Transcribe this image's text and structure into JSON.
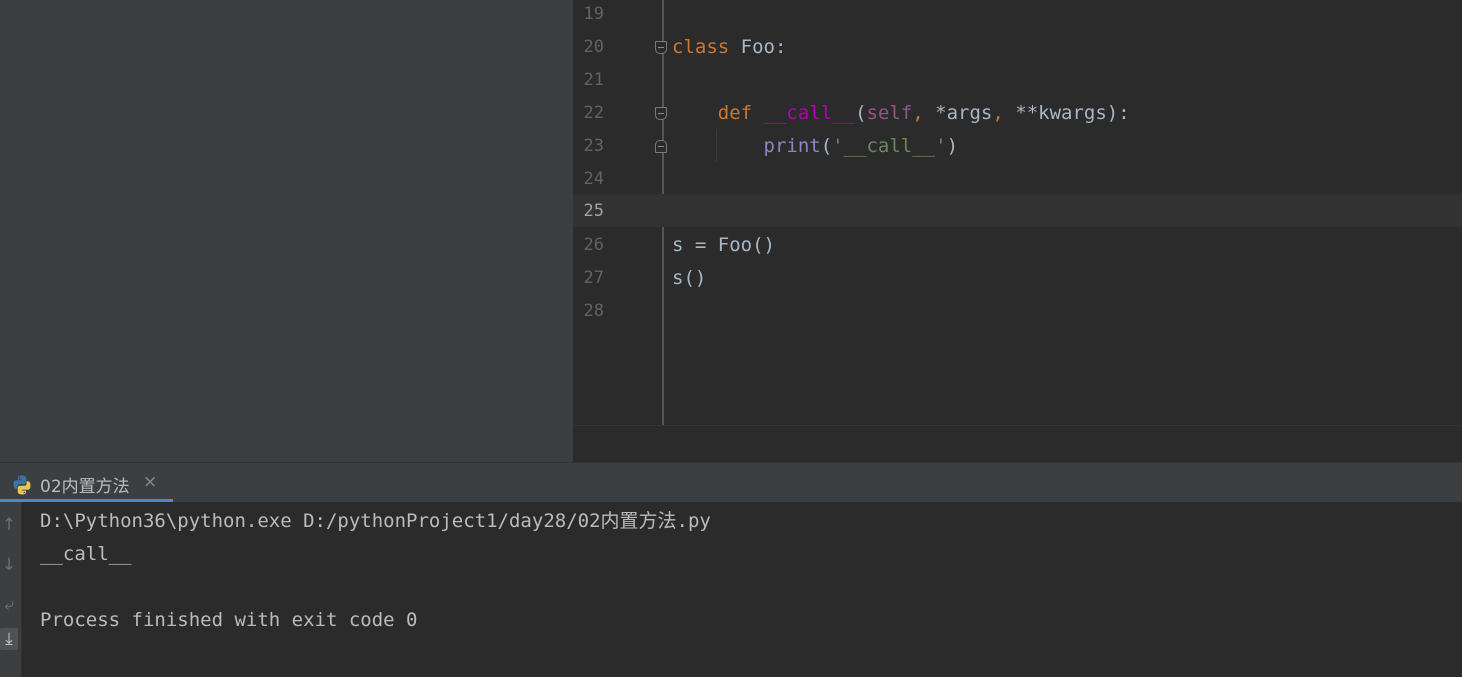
{
  "editor": {
    "lines": [
      {
        "no": "19"
      },
      {
        "no": "20",
        "t1": "class",
        "t2": " Foo:"
      },
      {
        "no": "21"
      },
      {
        "no": "22",
        "t1": "    ",
        "t2": "def",
        "t3": " ",
        "t4": "__call__",
        "t5": "(",
        "t6": "self",
        "t7": ",",
        "t8": " *args",
        "t9": ",",
        "t10": " **kwargs):"
      },
      {
        "no": "23",
        "t1": "        ",
        "t2": "print",
        "t3": "(",
        "t4": "'__call__'",
        "t5": ")"
      },
      {
        "no": "24"
      },
      {
        "no": "25"
      },
      {
        "no": "26",
        "t1": "s = Foo()"
      },
      {
        "no": "27",
        "t1": "s()"
      },
      {
        "no": "28"
      }
    ],
    "current_line": "25"
  },
  "run": {
    "tab_label": "02内置方法",
    "tab_close": "×",
    "toolbar_icons": [
      "arrow-up-icon",
      "arrow-down-icon",
      "soft-wrap-icon",
      "scroll-to-end-icon"
    ],
    "output": [
      "D:\\Python36\\python.exe D:/pythonProject1/day28/02内置方法.py",
      "__call__",
      "",
      "Process finished with exit code 0"
    ]
  },
  "colors": {
    "keyword": "#cc7832",
    "magic_method": "#b200b2",
    "self_param": "#94558d",
    "builtin": "#8888c6",
    "string": "#6a8759",
    "default_text": "#a9b7c6",
    "editor_bg": "#2b2b2b",
    "panel_bg": "#3c3f41",
    "tab_underline": "#4a88c7"
  }
}
